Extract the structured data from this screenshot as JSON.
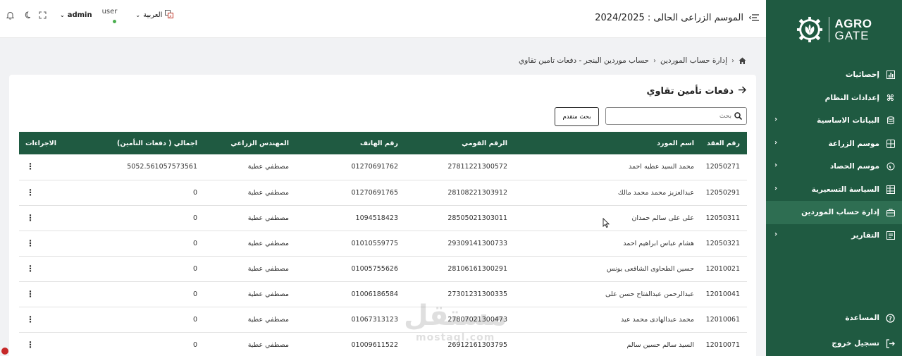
{
  "brand": {
    "line1": "AGRO",
    "line2": "GATE"
  },
  "sidebar": {
    "items": [
      {
        "label": "إحصائيات",
        "icon": "bar-chart-icon",
        "has_children": false,
        "active": false
      },
      {
        "label": "إعدادات النظام",
        "icon": "command-icon",
        "has_children": false,
        "active": false
      },
      {
        "label": "البيانات الاساسية",
        "icon": "database-icon",
        "has_children": true,
        "active": false
      },
      {
        "label": "موسم الزراعة",
        "icon": "calculator-icon",
        "has_children": true,
        "active": false
      },
      {
        "label": "موسم الحصاد",
        "icon": "plant-icon",
        "has_children": true,
        "active": false
      },
      {
        "label": "السياسة التسعيرية",
        "icon": "table-icon",
        "has_children": true,
        "active": false
      },
      {
        "label": "إدارة حساب الموردين",
        "icon": "bag-icon",
        "has_children": false,
        "active": true
      },
      {
        "label": "التقارير",
        "icon": "report-icon",
        "has_children": true,
        "active": false
      }
    ],
    "help_label": "المساعدة",
    "logout_label": "تسجيل خروج"
  },
  "header": {
    "season_label": "الموسم الزراعى الحالى : 2024/2025",
    "language": "العربية",
    "user_role": "user",
    "user_name": "admin"
  },
  "breadcrumb": {
    "items": [
      "إدارة حساب الموردين",
      "حساب موردين البنجر - دفعات تامين تقاوي"
    ]
  },
  "page": {
    "title": "دفعات تأمين تقاوي",
    "search_placeholder": "بحث",
    "advanced_search_label": "بحث متقدم"
  },
  "table": {
    "columns": [
      "رقم العقد",
      "اسم المورد",
      "الرقم القومي",
      "رقم الهاتف",
      "المهندس الزراعي",
      "اجمالي ( دفعات التأمين)",
      "الاجراءات"
    ],
    "rows": [
      [
        "12050271",
        "محمد السيد عطيه احمد",
        "27811221300572",
        "01270691762",
        "مصطفي عطية",
        "5052.561057573561"
      ],
      [
        "12050291",
        "عبدالعزيز محمد محمد مالك",
        "28108221303912",
        "01270691765",
        "مصطفي عطية",
        "0"
      ],
      [
        "12050311",
        "على على سالم حمدان",
        "28505021303011",
        "1094518423",
        "مصطفي عطية",
        "0"
      ],
      [
        "12050321",
        "هشام عباس ابراهيم احمد",
        "29309141300733",
        "01010559775",
        "مصطفي عطية",
        "0"
      ],
      [
        "12010021",
        "حسين الطحاوى الشافعى يونس",
        "28106161300291",
        "01005755626",
        "مصطفي عطية",
        "0"
      ],
      [
        "12010041",
        "عبدالرحمن عبدالفتاح حسن على",
        "27301231300335",
        "01006186584",
        "مصطفي عطية",
        "0"
      ],
      [
        "12010061",
        "محمد عبدالهادى محمد عيد",
        "27807021300473",
        "01067313123",
        "مصطفي عطية",
        "0"
      ],
      [
        "12010071",
        "السيد سالم حسين سالم",
        "26912161303795",
        "01009611522",
        "مصطفي عطية",
        "0"
      ]
    ]
  },
  "watermark": {
    "line1": "مستقل",
    "line2": "mostaql.com"
  },
  "colors": {
    "primary": "#1f5a41",
    "active": "#2e6e52",
    "online": "#4caf50"
  }
}
